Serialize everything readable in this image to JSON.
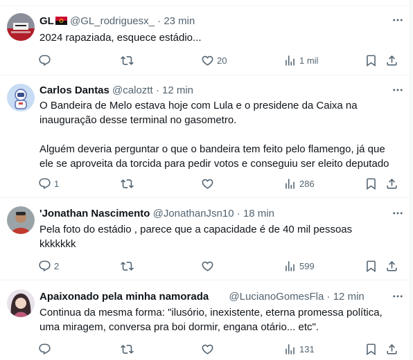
{
  "posts": [
    {
      "name": "GL",
      "handle": "@GL_rodriguesx_",
      "sep": "·",
      "time": "23 min",
      "lines": [
        "2024 rapaziada, esquece estádio..."
      ],
      "replies": "",
      "reposts": "",
      "likes": "20",
      "views": "1 mil"
    },
    {
      "name": "Carlos Dantas",
      "handle": "@caloztt",
      "sep": "·",
      "time": "12 min",
      "lines": [
        "O Bandeira de Melo estava hoje com Lula e o presidene da Caixa na",
        "inauguração desse terminal no gasometro.",
        "",
        "Alguém deveria perguntar o que o bandeira tem feito pelo flamengo, já que",
        "ele se aproveita da torcida para pedir votos e conseguiu ser eleito deputado"
      ],
      "replies": "1",
      "reposts": "",
      "likes": "",
      "views": "286"
    },
    {
      "name": "'Jonathan Nascimento",
      "handle": "@JonathanJsn10",
      "sep": "·",
      "time": "18 min",
      "lines": [
        "Pela foto do estádio , parece que a capacidade é de 40 mil pessoas",
        "kkkkkkk"
      ],
      "replies": "2",
      "reposts": "",
      "likes": "",
      "views": "599"
    },
    {
      "name": "Apaixonado pela minha namorada",
      "handle": "@LucianoGomesFla",
      "sep": "·",
      "time": "12 min",
      "lines": [
        "Continua da mesma forma: \"ilusório, inexistente, eterna promessa política,",
        "uma miragem, conversa pra boi dormir, engana otário... etc\"."
      ],
      "replies": "",
      "reposts": "",
      "likes": "",
      "views": "131"
    }
  ],
  "icons": {
    "reply": "reply-icon",
    "repost": "repost-icon",
    "like": "heart-icon",
    "views": "views-icon",
    "bookmark": "bookmark-icon",
    "share": "share-icon",
    "more": "more-icon",
    "flag": "angola-flag-icon"
  },
  "colors": {
    "text": "#0f1419",
    "secondary": "#536471",
    "divider": "#eff3f4"
  }
}
